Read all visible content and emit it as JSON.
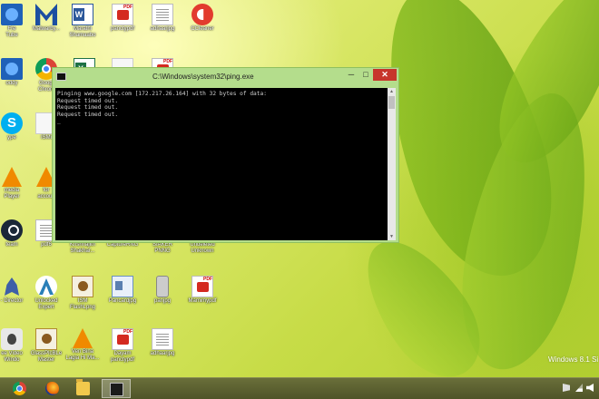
{
  "desktop": {
    "icons": [
      {
        "label": "Fre\nTube",
        "icon": "blue"
      },
      {
        "label": "Malwarby...",
        "icon": "malware"
      },
      {
        "label": "Marathi\nShamaabo",
        "icon": "word"
      },
      {
        "label": "panctypdf",
        "icon": "pdf"
      },
      {
        "label": "adhaarjpg",
        "icon": "doc"
      },
      {
        "label": "CCleaner",
        "icon": "ccleaner"
      },
      {
        "label": "oddy",
        "icon": "blue"
      },
      {
        "label": "Googl\nChrom",
        "icon": "chrome"
      },
      {
        "label": "",
        "icon": "excel"
      },
      {
        "label": "",
        "icon": "blank"
      },
      {
        "label": "",
        "icon": "pdf"
      },
      {
        "label": "ype",
        "icon": "skype"
      },
      {
        "label": "ISMi",
        "icon": "blank"
      },
      {
        "label": "media\nPlayer",
        "icon": "vlc"
      },
      {
        "label": "for\naccoun",
        "icon": "vlc"
      },
      {
        "label": "team",
        "icon": "steam"
      },
      {
        "label": "pdf6",
        "icon": "doc"
      },
      {
        "label": "Krishnajith\nShakhar...",
        "icon": "blank"
      },
      {
        "label": "CaptureRNG",
        "icon": "blank"
      },
      {
        "label": "SIAKER\nPNNG",
        "icon": "blank"
      },
      {
        "label": "Undeleted\nUnknown",
        "icon": "blank"
      },
      {
        "label": "- Director",
        "icon": "rocket"
      },
      {
        "label": "Unlocked\nExpert",
        "icon": "arrow"
      },
      {
        "label": "ISM\nFlashLpng",
        "icon": "cert"
      },
      {
        "label": "Pancardjpg",
        "icon": "card"
      },
      {
        "label": "panjpg",
        "icon": "phone"
      },
      {
        "label": "Mamimypdf",
        "icon": "pdf"
      },
      {
        "label": "ee Video\nWindo",
        "icon": "apple"
      },
      {
        "label": "GlassPlcBLe\nMaster",
        "icon": "cert"
      },
      {
        "label": "Ven Bina\nLagia Hi Ma...",
        "icon": "vlc"
      },
      {
        "label": "Dayam\npanctypdf",
        "icon": "pdf"
      },
      {
        "label": "adhaarjpg",
        "icon": "doc"
      }
    ]
  },
  "cmd_window": {
    "title": "C:\\Windows\\system32\\ping.exe",
    "minimize_label": "─",
    "maximize_label": "□",
    "close_label": "✕",
    "console_lines": [
      "Pinging www.google.com [172.217.26.164] with 32 bytes of data:",
      "Request timed out.",
      "Request timed out.",
      "Request timed out.",
      "_"
    ]
  },
  "watermark": "Windows 8.1 Si",
  "taskbar": {
    "items": [
      {
        "name": "chrome-taskbar-button",
        "icon": "tb-chrome",
        "active": false
      },
      {
        "name": "firefox-taskbar-button",
        "icon": "tb-ff",
        "active": false
      },
      {
        "name": "explorer-taskbar-button",
        "icon": "tb-folder",
        "active": false
      },
      {
        "name": "cmd-taskbar-button",
        "icon": "tb-cmd",
        "active": true
      }
    ]
  }
}
